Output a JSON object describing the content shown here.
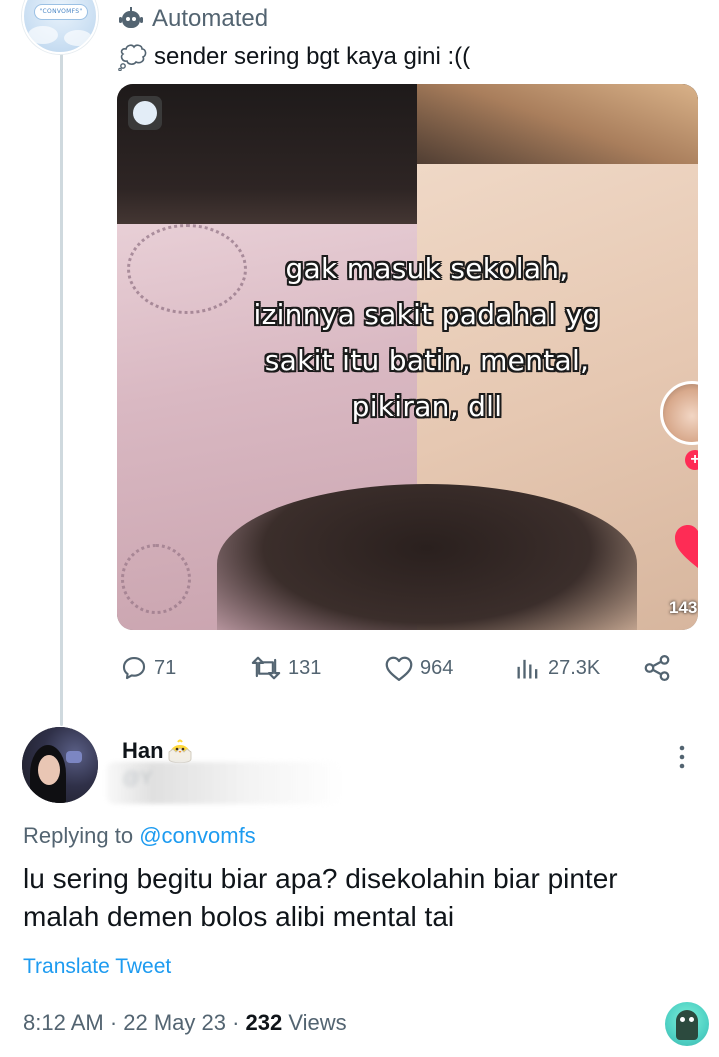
{
  "parent_tweet": {
    "automated_label": "Automated",
    "text": "sender sering bgt kaya gini :((",
    "media": {
      "caption_lines": [
        "gak masuk sekolah,",
        "izinnya sakit padahal yg",
        "sakit itu batin, mental,",
        "pikiran, dll"
      ],
      "tiktok_count": "143"
    },
    "actions": {
      "replies": "71",
      "retweets": "131",
      "likes": "964",
      "views": "27.3K"
    }
  },
  "reply_tweet": {
    "name": "Han",
    "handle_partial": "@Y",
    "replying_prefix": "Replying to",
    "replying_handle": "@convomfs",
    "text_lines": [
      "lu sering begitu biar apa? disekolahin biar pinter",
      "malah demen bolos alibi mental tai"
    ],
    "translate_label": "Translate Tweet",
    "timestamp": "8:12 AM · 22 May 23 · ",
    "views_count": "232",
    "views_label": " Views"
  },
  "colors": {
    "text_primary": "#0f1419",
    "text_secondary": "#536471",
    "link_blue": "#1d9bf0",
    "thread_line": "#cfd9de",
    "tiktok_red": "#fe2c55"
  },
  "icons": [
    "bot-icon",
    "thought-bubble-icon",
    "reply-icon",
    "retweet-icon",
    "like-icon",
    "views-icon",
    "share-icon",
    "chick-icon",
    "more-icon"
  ]
}
